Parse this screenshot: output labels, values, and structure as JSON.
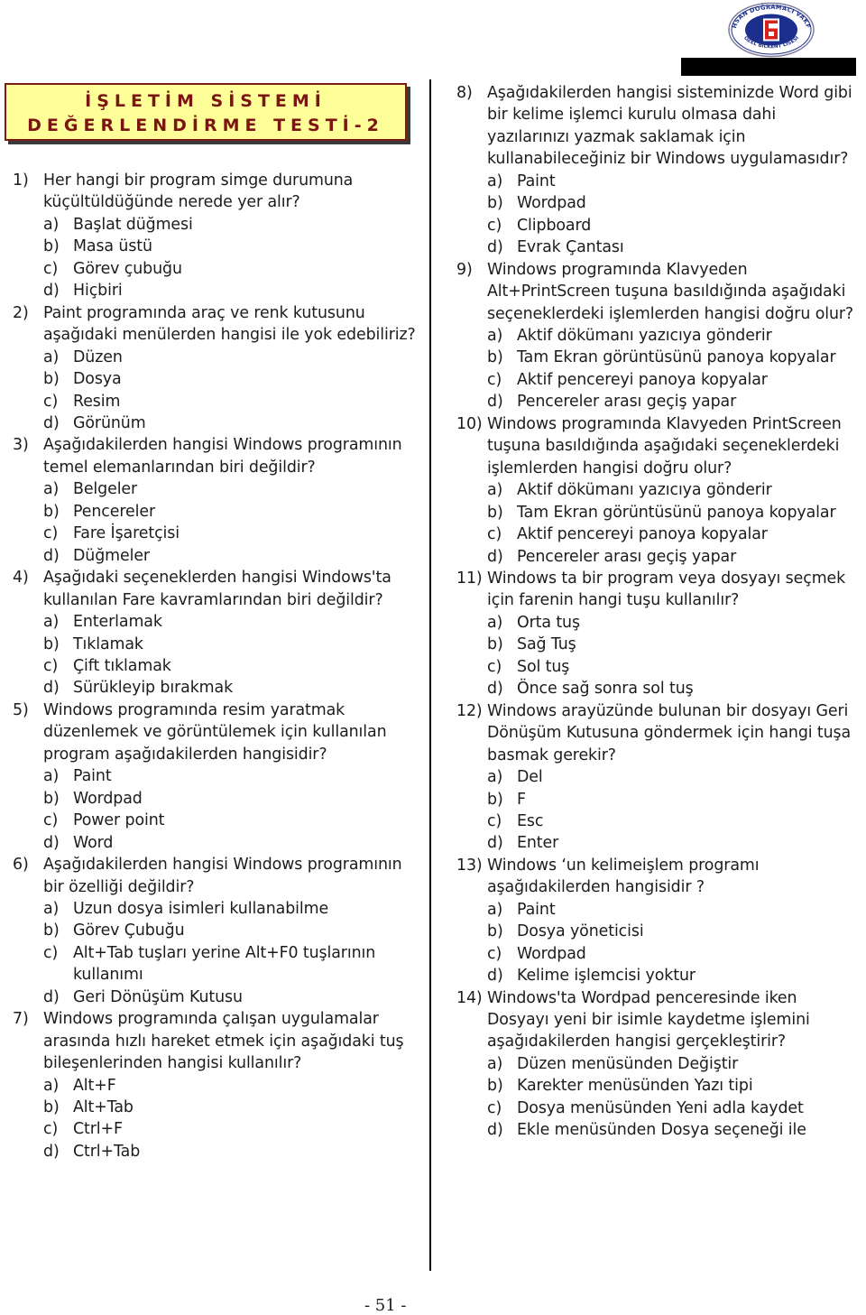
{
  "header": {
    "logo": {
      "icon": "school-logo-icon",
      "ring_text_top": "İHSAN DOĞRAMACI VAKFI",
      "ring_text_bottom": "ÖZEL BİLKENT LİSESİ",
      "colors": {
        "ring": "#1d2f8c",
        "mark": "#d8201c",
        "inner": "#ffffff"
      }
    },
    "redaction_bar_color": "#000000"
  },
  "title": {
    "line1": "İŞLETİM SİSTEMİ",
    "line2": "DEĞERLENDİRME TESTİ-2",
    "colors": {
      "background": "#ffff99",
      "text": "#7a1512",
      "border": "#7a1c12"
    }
  },
  "columns": {
    "left": [
      {
        "number": "1)",
        "stem": "Her hangi bir program simge durumuna küçültüldüğünde nerede yer alır?",
        "options": [
          {
            "letter": "a)",
            "text": "Başlat düğmesi"
          },
          {
            "letter": "b)",
            "text": "Masa üstü"
          },
          {
            "letter": "c)",
            "text": "Görev çubuğu"
          },
          {
            "letter": "d)",
            "text": "Hiçbiri"
          }
        ]
      },
      {
        "number": "2)",
        "stem": "Paint programında araç ve renk kutusunu aşağıdaki menülerden hangisi ile yok edebiliriz?",
        "options": [
          {
            "letter": "a)",
            "text": "Düzen"
          },
          {
            "letter": "b)",
            "text": "Dosya"
          },
          {
            "letter": "c)",
            "text": "Resim"
          },
          {
            "letter": "d)",
            "text": "Görünüm"
          }
        ]
      },
      {
        "number": "3)",
        "stem": "Aşağıdakilerden hangisi  Windows programının temel elemanlarından biri değildir?",
        "options": [
          {
            "letter": "a)",
            "text": "Belgeler"
          },
          {
            "letter": "b)",
            "text": "Pencereler"
          },
          {
            "letter": "c)",
            "text": "Fare İşaretçisi"
          },
          {
            "letter": "d)",
            "text": "Düğmeler"
          }
        ]
      },
      {
        "number": "4)",
        "stem": "Aşağıdaki seçeneklerden hangisi Windows'ta kullanılan Fare kavramlarından biri değildir?",
        "options": [
          {
            "letter": "a)",
            "text": "Enterlamak"
          },
          {
            "letter": "b)",
            "text": "Tıklamak"
          },
          {
            "letter": "c)",
            "text": "Çift tıklamak"
          },
          {
            "letter": "d)",
            "text": "Sürükleyip bırakmak"
          }
        ]
      },
      {
        "number": "5)",
        "stem": "Windows programında resim yaratmak düzenlemek ve görüntülemek için kullanılan program aşağıdakilerden hangisidir?",
        "options": [
          {
            "letter": "a)",
            "text": "Paint"
          },
          {
            "letter": "b)",
            "text": "Wordpad"
          },
          {
            "letter": "c)",
            "text": "Power point"
          },
          {
            "letter": "d)",
            "text": "Word"
          }
        ]
      },
      {
        "number": "6)",
        "stem": "Aşağıdakilerden hangisi  Windows programının bir özelliği değildir?",
        "options": [
          {
            "letter": "a)",
            "text": "Uzun dosya isimleri kullanabilme"
          },
          {
            "letter": "b)",
            "text": "Görev Çubuğu"
          },
          {
            "letter": "c)",
            "text": "Alt+Tab tuşları yerine Alt+F0 tuşlarının kullanımı"
          },
          {
            "letter": "d)",
            "text": "Geri Dönüşüm Kutusu"
          }
        ]
      },
      {
        "number": "7)",
        "stem": "Windows programında çalışan uygulamalar arasında hızlı hareket etmek için aşağıdaki tuş bileşenlerinden hangisi kullanılır?",
        "options": [
          {
            "letter": "a)",
            "text": "Alt+F"
          },
          {
            "letter": "b)",
            "text": "Alt+Tab"
          },
          {
            "letter": "c)",
            "text": "Ctrl+F"
          },
          {
            "letter": "d)",
            "text": "Ctrl+Tab"
          }
        ]
      }
    ],
    "right": [
      {
        "number": "8)",
        "stem": "Aşağıdakilerden hangisi sisteminizde Word gibi bir kelime işlemci kurulu olmasa dahi yazılarınızı yazmak saklamak için kullanabileceğiniz bir  Windows uygulamasıdır?",
        "options": [
          {
            "letter": "a)",
            "text": "Paint"
          },
          {
            "letter": "b)",
            "text": "Wordpad"
          },
          {
            "letter": "c)",
            "text": "Clipboard"
          },
          {
            "letter": "d)",
            "text": "Evrak Çantası"
          }
        ]
      },
      {
        "number": "9)",
        "stem": "Windows programında Klavyeden Alt+PrintScreen  tuşuna basıldığında aşağıdaki seçeneklerdeki işlemlerden hangisi doğru olur?",
        "options": [
          {
            "letter": "a)",
            "text": "Aktif dökümanı yazıcıya gönderir"
          },
          {
            "letter": "b)",
            "text": "Tam Ekran görüntüsünü panoya kopyalar"
          },
          {
            "letter": "c)",
            "text": "Aktif pencereyi panoya kopyalar"
          },
          {
            "letter": "d)",
            "text": "Pencereler arası geçiş yapar"
          }
        ]
      },
      {
        "number": "10)",
        "stem": "Windows programında Klavyeden PrintScreen  tuşuna basıldığında aşağıdaki seçeneklerdeki işlemlerden hangisi doğru olur?",
        "options": [
          {
            "letter": "a)",
            "text": "Aktif dökümanı yazıcıya gönderir"
          },
          {
            "letter": "b)",
            "text": "Tam Ekran görüntüsünü panoya kopyalar"
          },
          {
            "letter": "c)",
            "text": "Aktif pencereyi panoya kopyalar"
          },
          {
            "letter": "d)",
            "text": "Pencereler arası geçiş yapar"
          }
        ]
      },
      {
        "number": "11)",
        "stem": "Windows ta bir program veya dosyayı seçmek için farenin hangi tuşu kullanılır?",
        "options": [
          {
            "letter": "a)",
            "text": "Orta tuş"
          },
          {
            "letter": "b)",
            "text": "Sağ Tuş"
          },
          {
            "letter": "c)",
            "text": "Sol tuş"
          },
          {
            "letter": "d)",
            "text": "Önce sağ sonra sol tuş"
          }
        ]
      },
      {
        "number": "12)",
        "stem": "Windows arayüzünde bulunan bir dosyayı Geri Dönüşüm Kutusuna göndermek için hangi tuşa basmak gerekir?",
        "options": [
          {
            "letter": "a)",
            "text": "Del"
          },
          {
            "letter": "b)",
            "text": "F"
          },
          {
            "letter": "c)",
            "text": "Esc"
          },
          {
            "letter": "d)",
            "text": "Enter"
          }
        ]
      },
      {
        "number": "13)",
        "stem": "Windows ‘un kelimeişlem programı aşağıdakilerden hangisidir ?",
        "options": [
          {
            "letter": "a)",
            "text": "Paint"
          },
          {
            "letter": "b)",
            "text": "Dosya yöneticisi"
          },
          {
            "letter": "c)",
            "text": "Wordpad"
          },
          {
            "letter": "d)",
            "text": "Kelime işlemcisi yoktur"
          }
        ]
      },
      {
        "number": "14)",
        "stem": "Windows'ta Wordpad penceresinde iken Dosyayı yeni bir isimle kaydetme işlemini aşağıdakilerden hangisi gerçekleştirir?",
        "options": [
          {
            "letter": "a)",
            "text": "Düzen menüsünden Değiştir"
          },
          {
            "letter": "b)",
            "text": "Karekter menüsünden Yazı tipi"
          },
          {
            "letter": "c)",
            "text": "Dosya menüsünden Yeni adla kaydet"
          },
          {
            "letter": "d)",
            "text": "Ekle menüsünden Dosya seçeneği ile"
          }
        ]
      }
    ]
  },
  "footer": {
    "page_number": "- 51 -"
  }
}
